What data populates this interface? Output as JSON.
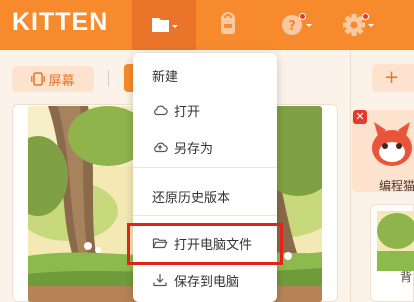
{
  "app": {
    "logo": "KITTEN"
  },
  "toolbar": {
    "screen_label": "屏幕",
    "plus_label": "+"
  },
  "file_menu": {
    "items": [
      {
        "label": "新建",
        "icon": "none"
      },
      {
        "label": "打开",
        "icon": "cloud-icon"
      },
      {
        "label": "另存为",
        "icon": "cloud-upload-icon"
      },
      {
        "label": "还原历史版本",
        "icon": "none"
      },
      {
        "label": "打开电脑文件",
        "icon": "folder-open-icon",
        "highlighted": true
      },
      {
        "label": "保存到电脑",
        "icon": "download-icon"
      }
    ]
  },
  "sprites": {
    "sprite_label": "编程猫",
    "background_label": "背"
  },
  "colors": {
    "brand": "#f78a2c",
    "brand_dark": "#e9742a",
    "highlight": "#e0231d"
  }
}
